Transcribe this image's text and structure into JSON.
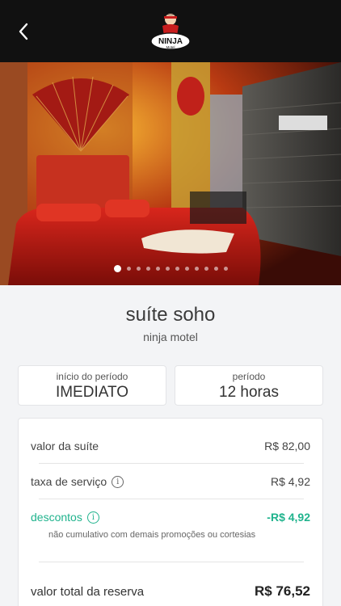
{
  "header": {
    "logo_text": "NINJA",
    "logo_subtext": "Motel"
  },
  "gallery": {
    "dot_count": 12,
    "active_index": 0
  },
  "suite": {
    "name": "suíte soho",
    "motel": "ninja motel"
  },
  "period": {
    "start_label": "início do período",
    "start_value": "IMEDIATO",
    "length_label": "período",
    "length_value": "12 horas"
  },
  "summary": {
    "suite_label": "valor da suíte",
    "suite_value": "R$ 82,00",
    "fee_label": "taxa de serviço",
    "fee_value": "R$ 4,92",
    "discount_label": "descontos",
    "discount_value": "-R$ 4,92",
    "discount_note": "não cumulativo com demais promoções ou cortesias",
    "total_label": "valor total da reserva",
    "total_value": "R$ 76,52"
  },
  "colors": {
    "topbar": "#111111",
    "accent_green": "#20b38d"
  }
}
